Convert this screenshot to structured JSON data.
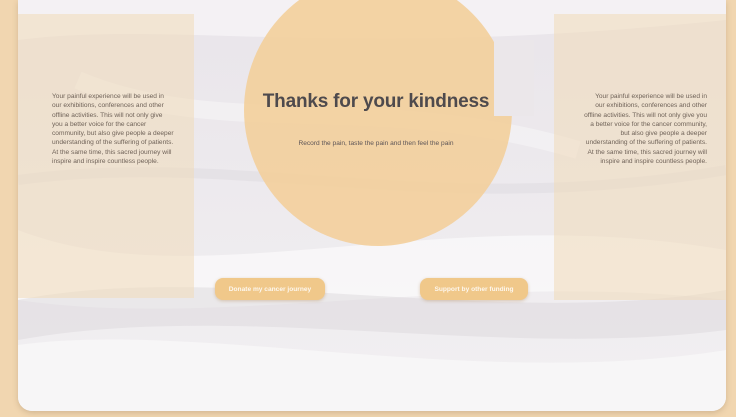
{
  "hero": {
    "title": "Thanks for your kindness",
    "subtitle": "Record the pain, taste the pain and then feel the pain"
  },
  "left_panel": {
    "text": "Your painful experience will be used in our exhibitions, conferences and other offline activities. This will not only give you a better voice for the cancer community, but also give people a deeper understanding of the suffering of patients. At the same time, this sacred journey will inspire and inspire countless people."
  },
  "right_panel": {
    "text": "Your painful experience will be used in our exhibitions, conferences and other offline activities. This will not only give you a better voice for the cancer community, but also give people a deeper understanding of the suffering of patients. At the same time, this sacred journey will inspire and inspire countless people."
  },
  "actions": {
    "donate_label": "Donate my cancer journey",
    "support_label": "Support by other funding"
  },
  "colors": {
    "accent": "#f0c88a",
    "circle": "#f3cf9b",
    "frame": "#f1d6b0",
    "title_text": "#4e4a4d"
  }
}
